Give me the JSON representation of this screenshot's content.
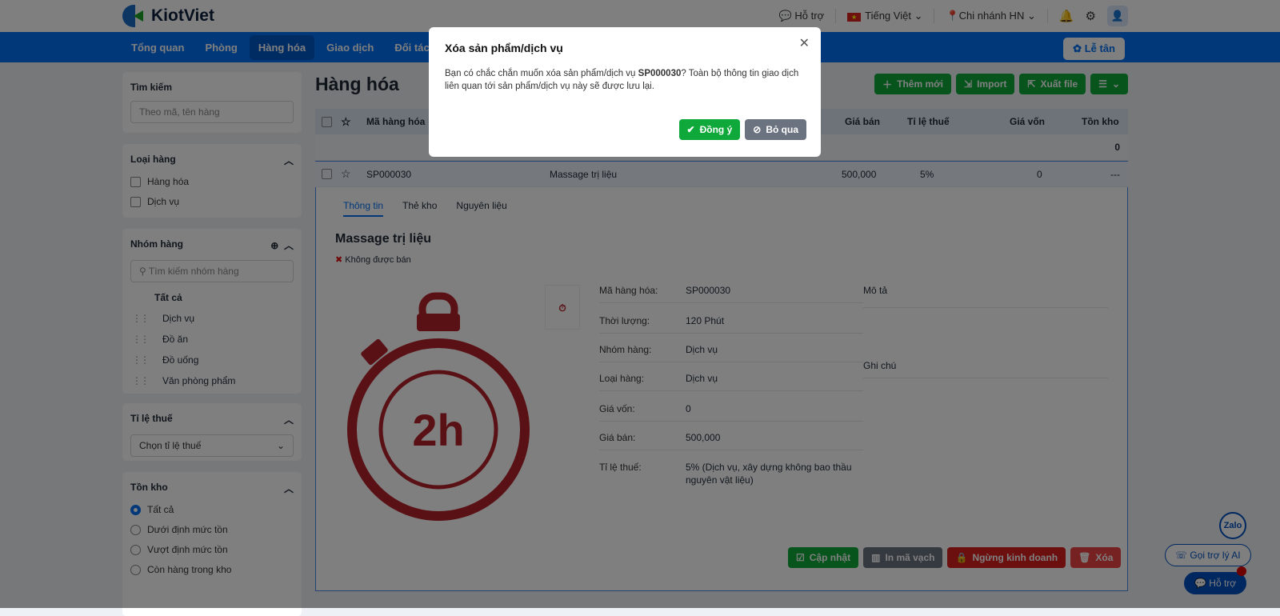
{
  "header": {
    "logo": "KiotViet",
    "support": "Hỗ trợ",
    "language": "Tiếng Việt",
    "branch": "Chi nhánh HN"
  },
  "nav": {
    "items": [
      "Tổng quan",
      "Phòng",
      "Hàng hóa",
      "Giao dịch",
      "Đối tác"
    ],
    "reception": "Lễ tân"
  },
  "sidebar": {
    "search": {
      "title": "Tìm kiếm",
      "placeholder": "Theo mã, tên hàng"
    },
    "type": {
      "title": "Loại hàng",
      "options": [
        "Hàng hóa",
        "Dịch vụ"
      ]
    },
    "group": {
      "title": "Nhóm hàng",
      "placeholder": "Tìm kiếm nhóm hàng",
      "all": "Tất cả",
      "items": [
        "Dịch vụ",
        "Đồ ăn",
        "Đồ uống",
        "Văn phòng phẩm"
      ]
    },
    "tax": {
      "title": "Tỉ lệ thuế",
      "placeholder": "Chọn tỉ lệ thuế"
    },
    "stock": {
      "title": "Tồn kho",
      "options": [
        "Tất cả",
        "Dưới định mức tồn",
        "Vượt định mức tồn",
        "Còn hàng trong kho"
      ]
    }
  },
  "main": {
    "title": "Hàng hóa",
    "buttons": {
      "add": "Thêm mới",
      "import": "Import",
      "export": "Xuất file"
    },
    "columns": [
      "Mã hàng hóa",
      "Giá bán",
      "Tỉ lệ thuế",
      "Giá vốn",
      "Tồn kho"
    ],
    "summary_stock": "0",
    "row": {
      "code": "SP000030",
      "name": "Massage trị liệu",
      "price": "500,000",
      "tax": "5%",
      "cost": "0",
      "stock": "---"
    },
    "detail": {
      "tabs": [
        "Thông tin",
        "Thẻ kho",
        "Nguyên liệu"
      ],
      "name": "Massage trị liệu",
      "status": "Không được bán",
      "image_text": "2h",
      "fields": [
        {
          "k": "Mã hàng hóa:",
          "v": "SP000030"
        },
        {
          "k": "Thời lượng:",
          "v": "120 Phút"
        },
        {
          "k": "Nhóm hàng:",
          "v": "Dịch vụ"
        },
        {
          "k": "Loại hàng:",
          "v": "Dịch vụ"
        },
        {
          "k": "Giá vốn:",
          "v": "0"
        },
        {
          "k": "Giá bán:",
          "v": "500,000"
        },
        {
          "k": "Tỉ lệ thuế:",
          "v": "5% (Dịch vụ, xây dựng không bao thầu nguyên vật liệu)"
        }
      ],
      "description": "Mô tả",
      "note": "Ghi chú",
      "actions": {
        "update": "Cập nhật",
        "barcode": "In mã vạch",
        "stop": "Ngừng kinh doanh",
        "delete": "Xóa"
      }
    }
  },
  "modal": {
    "title": "Xóa sản phẩm/dịch vụ",
    "text_before": "Bạn có chắc chắn muốn xóa sản phẩm/dịch vụ ",
    "code": "SP000030",
    "text_after": "? Toàn bộ thông tin giao dịch liên quan tới sản phẩm/dịch vụ này sẽ được lưu lại.",
    "confirm": "Đồng ý",
    "cancel": "Bỏ qua"
  },
  "floating": {
    "zalo": "Zalo",
    "ai": "Gọi trợ lý AI",
    "support": "Hỗ trợ"
  }
}
